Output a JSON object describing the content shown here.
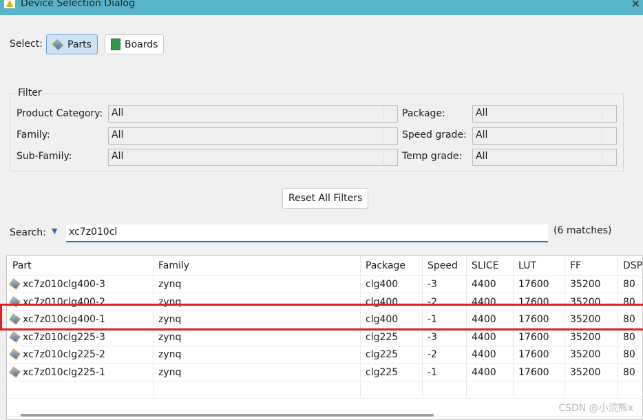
{
  "window": {
    "title": "Device Selection Dialog",
    "title_bar_color": "#58b4c8"
  },
  "select": {
    "label": "Select:",
    "parts": "Parts",
    "boards": "Boards",
    "selected": "Parts"
  },
  "filter": {
    "legend": "Filter",
    "left": [
      {
        "label": "Product Category:",
        "value": "All"
      },
      {
        "label": "Family:",
        "value": "All"
      },
      {
        "label": "Sub-Family:",
        "value": "All"
      }
    ],
    "right": [
      {
        "label": "Package:",
        "value": "All"
      },
      {
        "label": "Speed grade:",
        "value": "All"
      },
      {
        "label": "Temp grade:",
        "value": "All"
      }
    ]
  },
  "reset_label": "Reset All Filters",
  "search": {
    "label": "Search:",
    "value": "xc7z010cl",
    "matches": "(6 matches)"
  },
  "table": {
    "columns": [
      "Part",
      "Family",
      "Package",
      "Speed",
      "SLICE",
      "LUT",
      "FF",
      "DSP"
    ],
    "rows": [
      [
        "xc7z010clg400-3",
        "zynq",
        "clg400",
        "-3",
        "4400",
        "17600",
        "35200",
        "80"
      ],
      [
        "xc7z010clg400-2",
        "zynq",
        "clg400",
        "-2",
        "4400",
        "17600",
        "35200",
        "80"
      ],
      [
        "xc7z010clg400-1",
        "zynq",
        "clg400",
        "-1",
        "4400",
        "17600",
        "35200",
        "80"
      ],
      [
        "xc7z010clg225-3",
        "zynq",
        "clg225",
        "-3",
        "4400",
        "17600",
        "35200",
        "80"
      ],
      [
        "xc7z010clg225-2",
        "zynq",
        "clg225",
        "-2",
        "4400",
        "17600",
        "35200",
        "80"
      ],
      [
        "xc7z010clg225-1",
        "zynq",
        "clg225",
        "-1",
        "4400",
        "17600",
        "35200",
        "80"
      ]
    ],
    "highlighted_row": 2,
    "highlight_color": "#e02020"
  },
  "watermark": "CSDN @小浣熊x"
}
